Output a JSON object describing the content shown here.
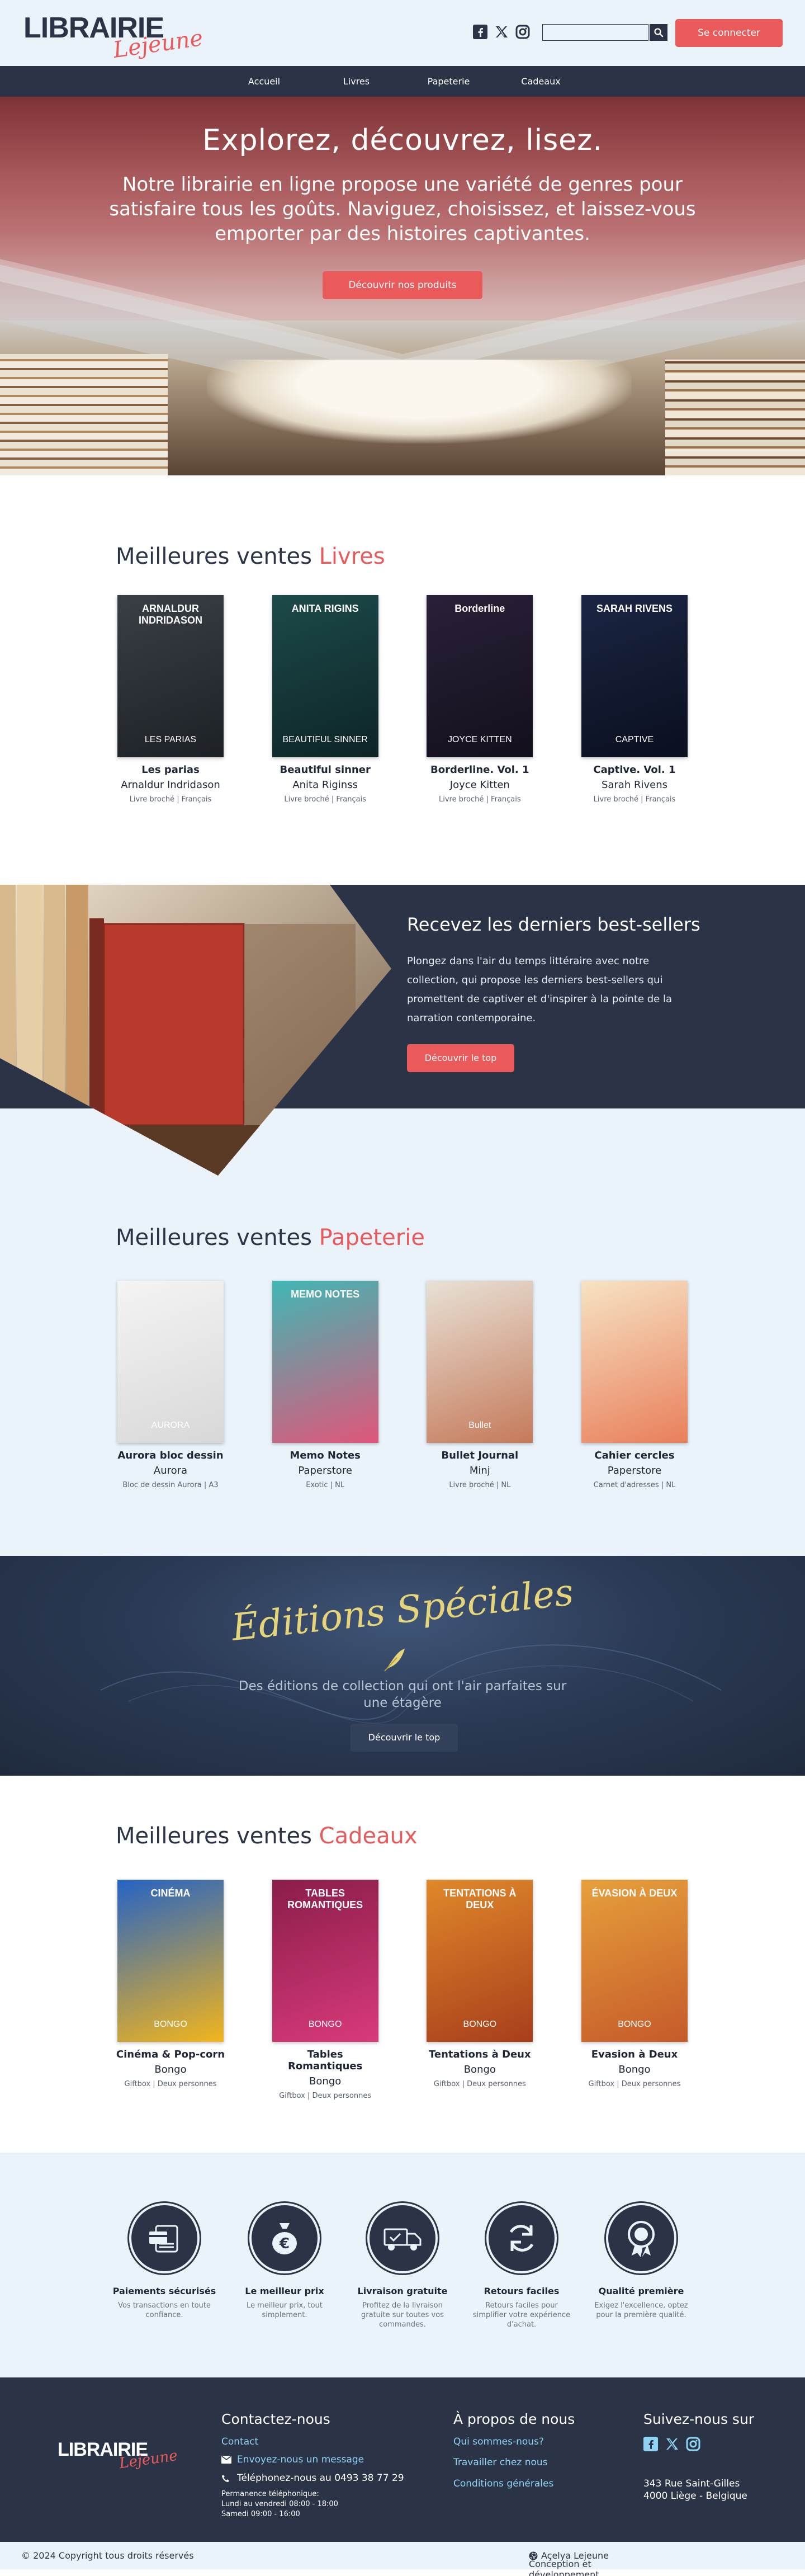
{
  "header": {
    "logo_main": "LIBRAIRIE",
    "logo_script": "Lejeune",
    "search_placeholder": "",
    "login_label": "Se connecter"
  },
  "nav": [
    "Accueil",
    "Livres",
    "Papeterie",
    "Cadeaux"
  ],
  "hero": {
    "title": "Explorez, découvrez, lisez.",
    "text": "Notre librairie en ligne propose une variété de genres pour satisfaire tous les goûts. Naviguez, choisissez, et laissez-vous emporter par des histoires captivantes.",
    "button": "Découvrir nos produits"
  },
  "books": {
    "title_prefix": "Meilleures ventes",
    "title_accent": "Livres",
    "items": [
      {
        "title": "Les parias",
        "author": "Arnaldur Indridason",
        "meta": "Livre broché | Français",
        "cover_top": "ARNALDUR INDRIDASON",
        "cover_sub": "LES PARIAS",
        "colors": [
          "#3a3f46",
          "#1d2126"
        ]
      },
      {
        "title": "Beautiful sinner",
        "author": "Anita Riginss",
        "meta": "Livre broché | Français",
        "cover_top": "ANITA RIGINS",
        "cover_sub": "BEAUTIFUL SINNER",
        "colors": [
          "#1d4a4a",
          "#0d2426"
        ]
      },
      {
        "title": "Borderline. Vol. 1",
        "author": "Joyce Kitten",
        "meta": "Livre broché | Français",
        "cover_top": "Borderline",
        "cover_sub": "JOYCE KITTEN",
        "colors": [
          "#2a2038",
          "#130f1c"
        ]
      },
      {
        "title": "Captive. Vol. 1",
        "author": "Sarah Rivens",
        "meta": "Livre broché | Français",
        "cover_top": "SARAH RIVENS",
        "cover_sub": "CAPTIVE",
        "colors": [
          "#1b2544",
          "#0a0f1e"
        ]
      }
    ]
  },
  "bestsellers": {
    "title": "Recevez les derniers best-sellers",
    "text": "Plongez dans l'air du temps littéraire avec notre collection, qui propose les derniers best-sellers qui promettent de captiver et d'inspirer à la pointe de la narration contemporaine.",
    "button": "Découvrir le top"
  },
  "stationery": {
    "title_prefix": "Meilleures ventes",
    "title_accent": "Papeterie",
    "items": [
      {
        "title": "Aurora bloc dessin",
        "author": "Aurora",
        "meta": "Bloc de dessin Aurora | A3",
        "cover_top": "",
        "cover_sub": "AURORA",
        "colors": [
          "#f4f4f4",
          "#d8d8d8"
        ]
      },
      {
        "title": "Memo Notes",
        "author": "Paperstore",
        "meta": "Exotic | NL",
        "cover_top": "MEMO NOTES",
        "cover_sub": "",
        "colors": [
          "#3fb7b4",
          "#e0567a"
        ]
      },
      {
        "title": "Bullet Journal",
        "author": "Minj",
        "meta": "Livre broché | NL",
        "cover_top": "",
        "cover_sub": "Bullet",
        "colors": [
          "#e8e1d6",
          "#c57a5a"
        ]
      },
      {
        "title": "Cahier cercles",
        "author": "Paperstore",
        "meta": "Carnet d'adresses | NL",
        "cover_top": "",
        "cover_sub": "",
        "colors": [
          "#f6e3c4",
          "#e97f5b"
        ]
      }
    ]
  },
  "editions": {
    "script": "Éditions Spéciales",
    "text": "Des éditions de collection qui ont l'air parfaites sur une étagère",
    "button": "Découvrir le top"
  },
  "gifts": {
    "title_prefix": "Meilleures ventes",
    "title_accent": "Cadeaux",
    "items": [
      {
        "title": "Cinéma & Pop-corn",
        "author": "Bongo",
        "meta": "Giftbox | Deux personnes",
        "cover_top": "CINÉMA",
        "cover_sub": "BONGO",
        "colors": [
          "#2563c4",
          "#f2b51d"
        ]
      },
      {
        "title": "Tables Romantiques",
        "author": "Bongo",
        "meta": "Giftbox | Deux personnes",
        "cover_top": "TABLES ROMANTIQUES",
        "cover_sub": "BONGO",
        "colors": [
          "#8a1d4a",
          "#d93a7a"
        ]
      },
      {
        "title": "Tentations à Deux",
        "author": "Bongo",
        "meta": "Giftbox | Deux personnes",
        "cover_top": "TENTATIONS À DEUX",
        "cover_sub": "BONGO",
        "colors": [
          "#e0882a",
          "#a83e1c"
        ]
      },
      {
        "title": "Evasion à Deux",
        "author": "Bongo",
        "meta": "Giftbox | Deux personnes",
        "cover_top": "ÉVASION À DEUX",
        "cover_sub": "BONGO",
        "colors": [
          "#e7a03b",
          "#c55a2a"
        ]
      }
    ]
  },
  "features": [
    {
      "title": "Paiements sécurisés",
      "text": "Vos transactions en toute confiance.",
      "icon": "card-icon"
    },
    {
      "title": "Le meilleur prix",
      "text": "Le meilleur prix, tout simplement.",
      "icon": "euro-bag-icon"
    },
    {
      "title": "Livraison gratuite",
      "text": "Profitez de la livraison gratuite sur toutes vos commandes.",
      "icon": "truck-icon"
    },
    {
      "title": "Retours faciles",
      "text": "Retours faciles pour simplifier votre expérience d'achat.",
      "icon": "return-icon"
    },
    {
      "title": "Qualité première",
      "text": "Exigez l'excellence, optez pour la première qualité.",
      "icon": "award-icon"
    }
  ],
  "footer": {
    "contact_title": "Contactez-nous",
    "contact_link": "Contact",
    "message_link": "Envoyez-nous un message",
    "phone": "Téléphonez-nous au 0493 38 77 29",
    "hours_title": "Permanence téléphonique:",
    "hours_week": "Lundi au vendredi 08:00 - 18:00",
    "hours_sat": "Samedi 09:00 - 16:00",
    "about_title": "À propos de nous",
    "about_links": [
      "Qui sommes-nous?",
      "Travailler chez nous",
      "Conditions générales"
    ],
    "follow_title": "Suivez-nous sur",
    "address_1": "343 Rue Saint-Gilles",
    "address_2": "4000 Liège - Belgique"
  },
  "bottom": {
    "copyright": "© 2024 Copyright tous droits réservés",
    "credit_prefix": "Conception et développement par",
    "credit_name": "Açelya Lejeune"
  }
}
